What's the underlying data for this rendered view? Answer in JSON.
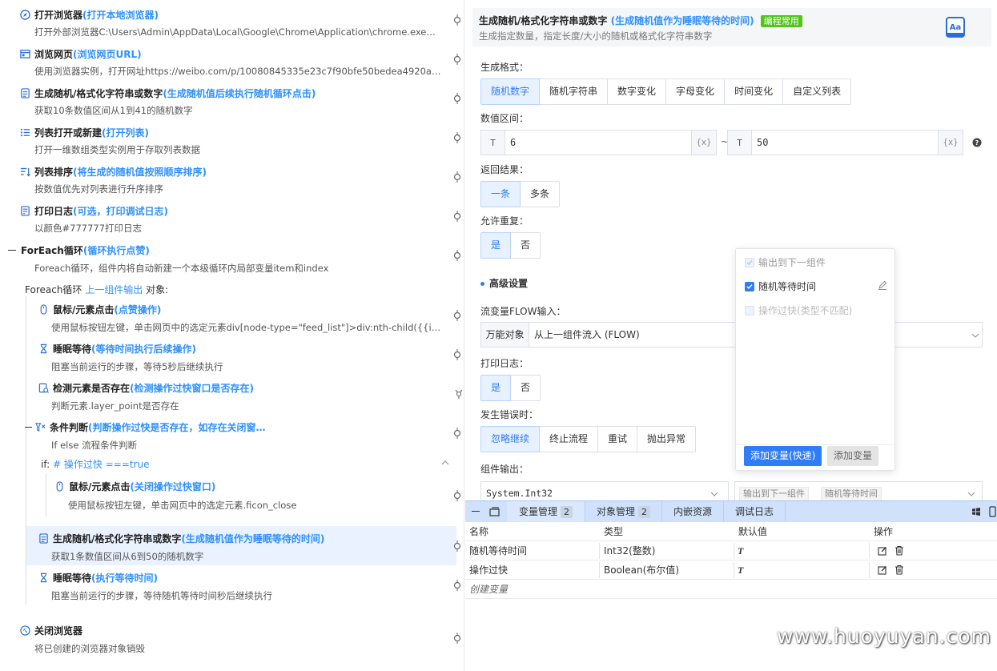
{
  "workflow": {
    "steps": [
      {
        "title": "打开浏览器",
        "hl": "(打开本地浏览器)",
        "desc": "打开外部浏览器C:\\Users\\Admin\\AppData\\Local\\Google\\Chrome\\Application\\chrome.exe，设…",
        "icon": "compass-icon"
      },
      {
        "title": "浏览网页",
        "hl": "(浏览网页URL)",
        "desc": "使用浏览器实例，打开网址https://weibo.com/p/10080845335e23c7f90bfe50bedea4920a5940…",
        "icon": "browser-window-icon"
      },
      {
        "title": "生成随机/格式化字符串或数字",
        "hl": "(生成随机值后续执行随机循环点击)",
        "desc": "获取10条数值区间从1到41的随机数字",
        "icon": "random-generator-icon"
      },
      {
        "title": "列表打开或新建",
        "hl": "(打开列表)",
        "desc": "打开一维数组类型实例用于存取列表数据",
        "icon": "list-icon"
      },
      {
        "title": "列表排序",
        "hl": "(将生成的随机值按照顺序排序)",
        "desc": "按数值优先对列表进行升序排序",
        "icon": "list-sort-icon"
      },
      {
        "title": "打印日志",
        "hl": "(可选，打印调试日志)",
        "desc": "以颜色#777777打印日志",
        "icon": "log-icon"
      },
      {
        "title": "ForEach循环",
        "hl": " (循环执行点赞)",
        "desc": "Foreach循环，组件内将自动新建一个本级循环内局部变量item和index",
        "icon": "collapse-icon"
      }
    ],
    "foreach_label": {
      "prefix": "Foreach循环 ",
      "link": "上一组件输出",
      "suffix": " 对象:"
    },
    "inner_steps": [
      {
        "title": "鼠标/元素点击",
        "hl": "(点赞操作)",
        "desc": "使用鼠标按钮左键，单击网页中的选定元素div[node-type=\"feed_list\"]>div:nth-child({{item}}…",
        "icon": "mouse-icon"
      },
      {
        "title": "睡眠等待",
        "hl": "(等待时间执行后续操作)",
        "desc": "阻塞当前运行的步骤，等待5秒后继续执行",
        "icon": "hourglass-icon"
      },
      {
        "title": "检测元素是否存在",
        "hl": "(检测操作过快窗口是否存在)",
        "desc": "判断元素.layer_point是否存在",
        "icon": "element-check-icon"
      },
      {
        "title": "条件判断",
        "hl": "(判断操作过快是否存在，如存在关闭窗…",
        "desc": "If else 流程条件判断",
        "icon": "condition-icon"
      }
    ],
    "if_label": {
      "prefix": "if:  ",
      "expr": "# 操作过快 ===true"
    },
    "if_steps": [
      {
        "title": "鼠标/元素点击",
        "hl": "(关闭操作过快窗口)",
        "desc": "使用鼠标按钮左键，单击网页中的选定元素.ficon_close",
        "icon": "mouse-icon"
      }
    ],
    "after_steps": [
      {
        "title": "生成随机/格式化字符串或数字",
        "hl": "(生成随机值作为睡眠等待的时间)",
        "desc": "获取1条数值区间从6到50的随机数字",
        "icon": "random-generator-icon"
      },
      {
        "title": "睡眠等待",
        "hl": "(执行等待时间)",
        "desc": "阻塞当前运行的步骤，等待随机等待时间秒后继续执行",
        "icon": "hourglass-icon"
      }
    ],
    "final_step": {
      "title": "关闭浏览器",
      "desc": "将已创建的浏览器对象销毁",
      "icon": "close-browser-icon"
    }
  },
  "config": {
    "title": "生成随机/格式化字符串或数字",
    "title_hl": "(生成随机值作为睡眠等待的时间)",
    "badge": "编程常用",
    "subtitle": "生成指定数量，指定长度/大小的随机或格式化字符串数字",
    "format_label": "生成格式：",
    "format_options": [
      "随机数字",
      "随机字符串",
      "数字变化",
      "字母变化",
      "时间变化",
      "自定义列表"
    ],
    "range_label": "数值区间：",
    "range_min": "6",
    "range_max": "50",
    "type_prefix": "T",
    "brace": "{x}",
    "tilde": "~",
    "result_label": "返回结果：",
    "result_options": [
      "一条",
      "多条"
    ],
    "repeat_label": "允许重复：",
    "repeat_options": [
      "是",
      "否"
    ],
    "advanced_label": "高级设置",
    "flow_label": "流变量FLOW输入：",
    "flow_prefix": "万能对象",
    "flow_value": "从上一组件流入 (FLOW)",
    "log_label": "打印日志：",
    "log_options": [
      "是",
      "否"
    ],
    "error_label": "发生错误时：",
    "error_options": [
      "忽略继续",
      "终止流程",
      "重试",
      "抛出异常"
    ],
    "output_label": "组件输出：",
    "output_type": "System.Int32",
    "output_tag1": "输出到下一组件",
    "output_tag2": "随机等待时间"
  },
  "popup": {
    "items": [
      {
        "label": "输出到下一组件",
        "checked": true,
        "disabled": true
      },
      {
        "label": "随机等待时间",
        "checked": true,
        "disabled": false
      },
      {
        "label": "操作过快(类型不匹配)",
        "checked": false,
        "disabled": true
      }
    ],
    "add_quick": "添加变量(快速)",
    "add": "添加变量"
  },
  "bottom": {
    "tabs": [
      {
        "label": "变量管理",
        "count": "2"
      },
      {
        "label": "对象管理",
        "count": "2"
      },
      {
        "label": "内嵌资源",
        "count": ""
      },
      {
        "label": "调试日志",
        "count": ""
      }
    ],
    "columns": [
      "名称",
      "类型",
      "默认值",
      "操作"
    ],
    "rows": [
      {
        "name": "随机等待时间",
        "type": "Int32(整数)",
        "default": "T"
      },
      {
        "name": "操作过快",
        "type": "Boolean(布尔值)",
        "default": "T"
      }
    ],
    "create": "创建变量"
  },
  "watermark": "www.huoyuyan.com",
  "colors": {
    "accent": "#2f7cf6",
    "highlight": "#2f90ff",
    "badge": "#52c41a",
    "tabbar": "#cfe1fb"
  }
}
